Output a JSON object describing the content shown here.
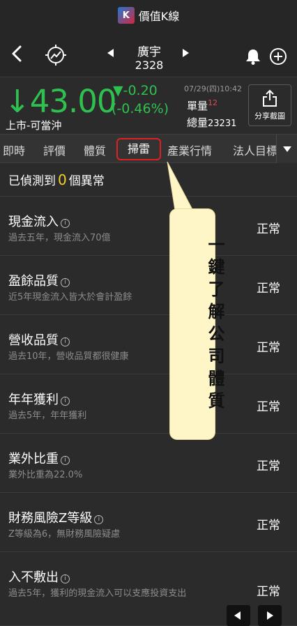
{
  "app": {
    "title": "價值K線",
    "logo_text": "K"
  },
  "nav": {
    "back_icon": "back-chevron-icon",
    "chart_icon": "chart-trend-icon",
    "stock_name": "廣宇",
    "stock_code": "2328",
    "bell_icon": "bell-icon",
    "add_icon": "plus-circle-icon"
  },
  "quote": {
    "price": "43.00",
    "price_arrow": "↓",
    "change": "▼-0.20",
    "change_pct": "(-0.46%)",
    "market_label": "上市-可當沖",
    "time": "07/29(四)10:42",
    "lot_label": "單量",
    "lot_value": "12",
    "volume_label": "總量",
    "volume_value": "23231",
    "share_label": "分享截圖"
  },
  "tabs": {
    "items": [
      "即時",
      "評價",
      "體質",
      "掃雷",
      "產業行情",
      "法人目標"
    ],
    "active": "掃雷"
  },
  "detected": {
    "prefix": "已偵測到",
    "count": "0",
    "suffix": "個異常"
  },
  "rows": [
    {
      "title": "現金流入",
      "desc": "過去五年，現金流入70億",
      "status": "正常"
    },
    {
      "title": "盈餘品質",
      "desc": "近5年現金流入皆大於會計盈餘",
      "status": "正常"
    },
    {
      "title": "營收品質",
      "desc": "過去10年，營收品質都很健康",
      "status": "正常"
    },
    {
      "title": "年年獲利",
      "desc": "過去5年，年年獲利",
      "status": "正常"
    },
    {
      "title": "業外比重",
      "desc": "業外比重為22.0%",
      "status": "正常"
    },
    {
      "title": "財務風險Z等級",
      "desc": "Z等級為6，無財務風險疑慮",
      "status": "正常"
    },
    {
      "title": "入不敷出",
      "desc": "過去5年，獲利的現金流入可以支應投資支出",
      "status": "正常"
    }
  ],
  "callout": {
    "text": "一鍵了解公司體質"
  },
  "colors": {
    "up": "#e5484d",
    "down": "#2ec14f",
    "highlight": "#f5d225",
    "callout_bg": "#fff6c8",
    "active_tab_border": "#e02020"
  }
}
